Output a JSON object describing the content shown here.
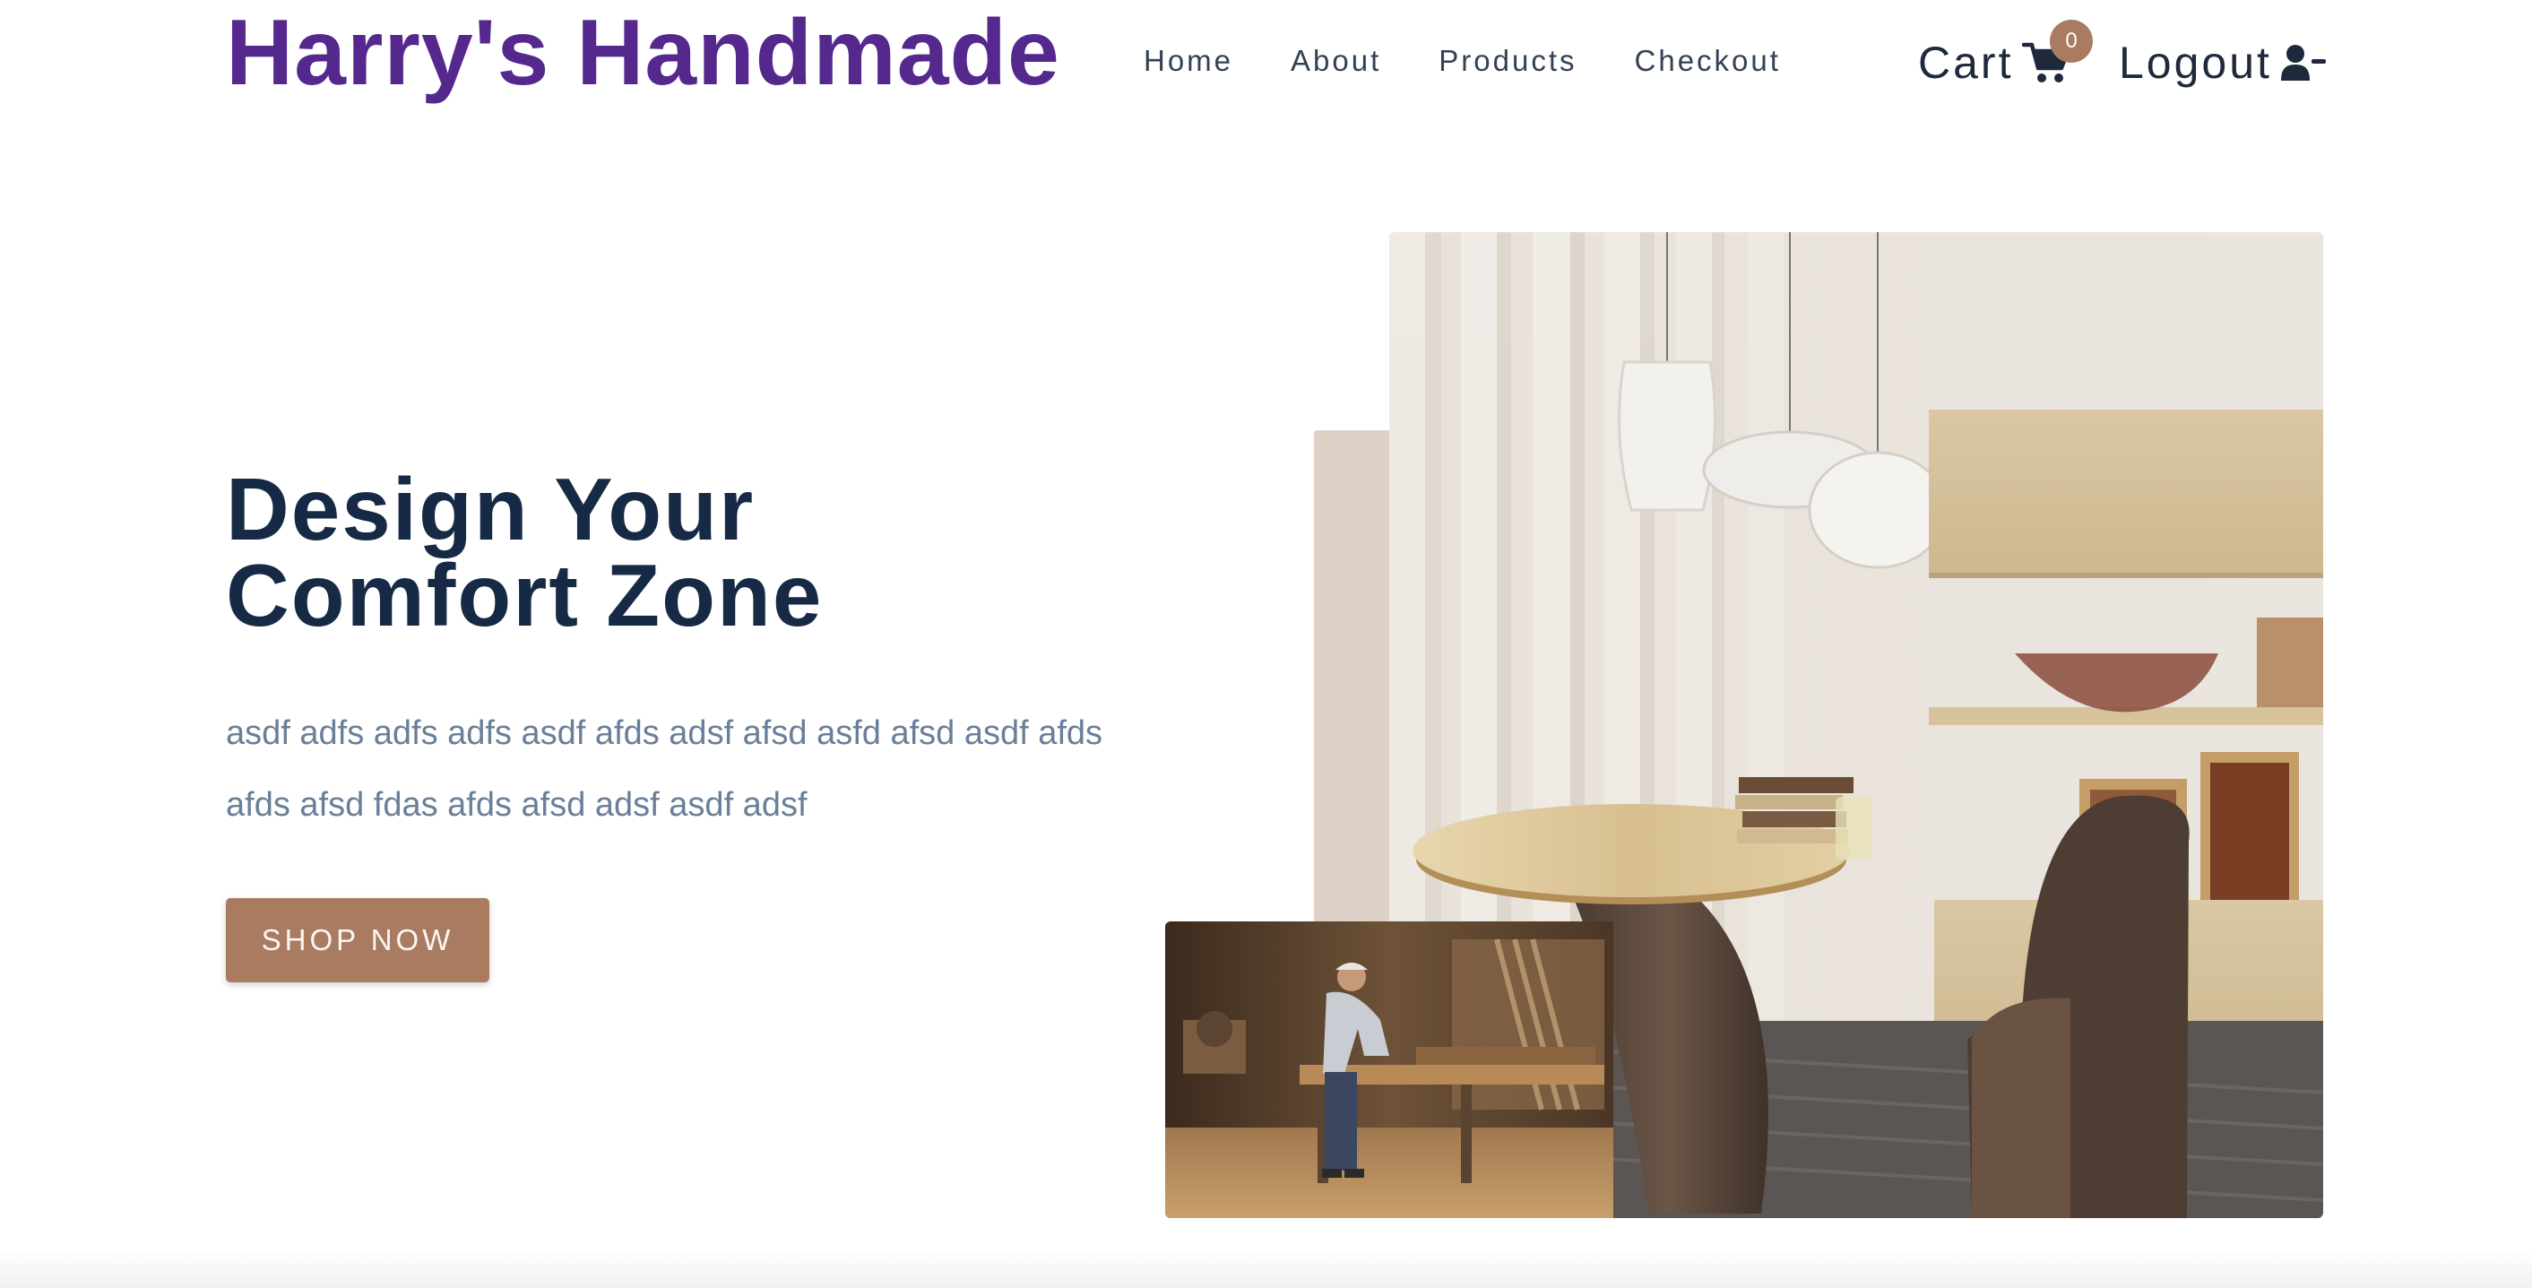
{
  "brand": {
    "name": "Harry's Handmade",
    "color": "#55288e"
  },
  "nav": {
    "items": [
      {
        "label": "Home"
      },
      {
        "label": "About"
      },
      {
        "label": "Products"
      },
      {
        "label": "Checkout"
      }
    ]
  },
  "cart": {
    "label": "Cart",
    "count": "0",
    "icon": "cart-icon"
  },
  "account": {
    "label": "Logout",
    "icon": "user-minus-icon"
  },
  "hero": {
    "title_line1": "Design Your",
    "title_line2": "Comfort Zone",
    "text": "asdf adfs adfs adfs asdf afds adsf afsd asfd afsd asdf afds afds afsd fdas afds afsd adsf asdf adsf",
    "button_label": "SHOP NOW"
  },
  "colors": {
    "accent": "#a97c62",
    "heading": "#172a45",
    "body_text": "#6a7f98",
    "accent_block": "#ded1c7"
  }
}
